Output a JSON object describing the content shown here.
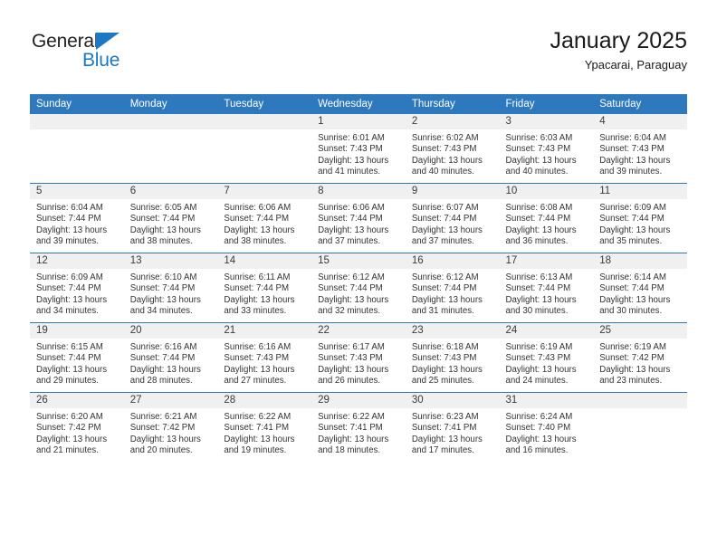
{
  "brand": {
    "name_top": "General",
    "name_bottom": "Blue",
    "triangle_color": "#1b78c2",
    "text_color": "#231f20"
  },
  "header": {
    "title": "January 2025",
    "location": "Ypacarai, Paraguay"
  },
  "theme": {
    "header_blue": "#2e79bd",
    "daynum_band": "#f0f0f0",
    "body_text": "#333333"
  },
  "calendar": {
    "weekday_headers": [
      "Sunday",
      "Monday",
      "Tuesday",
      "Wednesday",
      "Thursday",
      "Friday",
      "Saturday"
    ],
    "weeks": [
      [
        {
          "day": "",
          "empty": true,
          "sunrise": "",
          "sunset": "",
          "daylight": ""
        },
        {
          "day": "",
          "empty": true,
          "sunrise": "",
          "sunset": "",
          "daylight": ""
        },
        {
          "day": "",
          "empty": true,
          "sunrise": "",
          "sunset": "",
          "daylight": ""
        },
        {
          "day": "1",
          "sunrise": "Sunrise: 6:01 AM",
          "sunset": "Sunset: 7:43 PM",
          "daylight": "Daylight: 13 hours and 41 minutes."
        },
        {
          "day": "2",
          "sunrise": "Sunrise: 6:02 AM",
          "sunset": "Sunset: 7:43 PM",
          "daylight": "Daylight: 13 hours and 40 minutes."
        },
        {
          "day": "3",
          "sunrise": "Sunrise: 6:03 AM",
          "sunset": "Sunset: 7:43 PM",
          "daylight": "Daylight: 13 hours and 40 minutes."
        },
        {
          "day": "4",
          "sunrise": "Sunrise: 6:04 AM",
          "sunset": "Sunset: 7:43 PM",
          "daylight": "Daylight: 13 hours and 39 minutes."
        }
      ],
      [
        {
          "day": "5",
          "sunrise": "Sunrise: 6:04 AM",
          "sunset": "Sunset: 7:44 PM",
          "daylight": "Daylight: 13 hours and 39 minutes."
        },
        {
          "day": "6",
          "sunrise": "Sunrise: 6:05 AM",
          "sunset": "Sunset: 7:44 PM",
          "daylight": "Daylight: 13 hours and 38 minutes."
        },
        {
          "day": "7",
          "sunrise": "Sunrise: 6:06 AM",
          "sunset": "Sunset: 7:44 PM",
          "daylight": "Daylight: 13 hours and 38 minutes."
        },
        {
          "day": "8",
          "sunrise": "Sunrise: 6:06 AM",
          "sunset": "Sunset: 7:44 PM",
          "daylight": "Daylight: 13 hours and 37 minutes."
        },
        {
          "day": "9",
          "sunrise": "Sunrise: 6:07 AM",
          "sunset": "Sunset: 7:44 PM",
          "daylight": "Daylight: 13 hours and 37 minutes."
        },
        {
          "day": "10",
          "sunrise": "Sunrise: 6:08 AM",
          "sunset": "Sunset: 7:44 PM",
          "daylight": "Daylight: 13 hours and 36 minutes."
        },
        {
          "day": "11",
          "sunrise": "Sunrise: 6:09 AM",
          "sunset": "Sunset: 7:44 PM",
          "daylight": "Daylight: 13 hours and 35 minutes."
        }
      ],
      [
        {
          "day": "12",
          "sunrise": "Sunrise: 6:09 AM",
          "sunset": "Sunset: 7:44 PM",
          "daylight": "Daylight: 13 hours and 34 minutes."
        },
        {
          "day": "13",
          "sunrise": "Sunrise: 6:10 AM",
          "sunset": "Sunset: 7:44 PM",
          "daylight": "Daylight: 13 hours and 34 minutes."
        },
        {
          "day": "14",
          "sunrise": "Sunrise: 6:11 AM",
          "sunset": "Sunset: 7:44 PM",
          "daylight": "Daylight: 13 hours and 33 minutes."
        },
        {
          "day": "15",
          "sunrise": "Sunrise: 6:12 AM",
          "sunset": "Sunset: 7:44 PM",
          "daylight": "Daylight: 13 hours and 32 minutes."
        },
        {
          "day": "16",
          "sunrise": "Sunrise: 6:12 AM",
          "sunset": "Sunset: 7:44 PM",
          "daylight": "Daylight: 13 hours and 31 minutes."
        },
        {
          "day": "17",
          "sunrise": "Sunrise: 6:13 AM",
          "sunset": "Sunset: 7:44 PM",
          "daylight": "Daylight: 13 hours and 30 minutes."
        },
        {
          "day": "18",
          "sunrise": "Sunrise: 6:14 AM",
          "sunset": "Sunset: 7:44 PM",
          "daylight": "Daylight: 13 hours and 30 minutes."
        }
      ],
      [
        {
          "day": "19",
          "sunrise": "Sunrise: 6:15 AM",
          "sunset": "Sunset: 7:44 PM",
          "daylight": "Daylight: 13 hours and 29 minutes."
        },
        {
          "day": "20",
          "sunrise": "Sunrise: 6:16 AM",
          "sunset": "Sunset: 7:44 PM",
          "daylight": "Daylight: 13 hours and 28 minutes."
        },
        {
          "day": "21",
          "sunrise": "Sunrise: 6:16 AM",
          "sunset": "Sunset: 7:43 PM",
          "daylight": "Daylight: 13 hours and 27 minutes."
        },
        {
          "day": "22",
          "sunrise": "Sunrise: 6:17 AM",
          "sunset": "Sunset: 7:43 PM",
          "daylight": "Daylight: 13 hours and 26 minutes."
        },
        {
          "day": "23",
          "sunrise": "Sunrise: 6:18 AM",
          "sunset": "Sunset: 7:43 PM",
          "daylight": "Daylight: 13 hours and 25 minutes."
        },
        {
          "day": "24",
          "sunrise": "Sunrise: 6:19 AM",
          "sunset": "Sunset: 7:43 PM",
          "daylight": "Daylight: 13 hours and 24 minutes."
        },
        {
          "day": "25",
          "sunrise": "Sunrise: 6:19 AM",
          "sunset": "Sunset: 7:42 PM",
          "daylight": "Daylight: 13 hours and 23 minutes."
        }
      ],
      [
        {
          "day": "26",
          "sunrise": "Sunrise: 6:20 AM",
          "sunset": "Sunset: 7:42 PM",
          "daylight": "Daylight: 13 hours and 21 minutes."
        },
        {
          "day": "27",
          "sunrise": "Sunrise: 6:21 AM",
          "sunset": "Sunset: 7:42 PM",
          "daylight": "Daylight: 13 hours and 20 minutes."
        },
        {
          "day": "28",
          "sunrise": "Sunrise: 6:22 AM",
          "sunset": "Sunset: 7:41 PM",
          "daylight": "Daylight: 13 hours and 19 minutes."
        },
        {
          "day": "29",
          "sunrise": "Sunrise: 6:22 AM",
          "sunset": "Sunset: 7:41 PM",
          "daylight": "Daylight: 13 hours and 18 minutes."
        },
        {
          "day": "30",
          "sunrise": "Sunrise: 6:23 AM",
          "sunset": "Sunset: 7:41 PM",
          "daylight": "Daylight: 13 hours and 17 minutes."
        },
        {
          "day": "31",
          "sunrise": "Sunrise: 6:24 AM",
          "sunset": "Sunset: 7:40 PM",
          "daylight": "Daylight: 13 hours and 16 minutes."
        },
        {
          "day": "",
          "empty": true,
          "sunrise": "",
          "sunset": "",
          "daylight": ""
        }
      ]
    ]
  }
}
